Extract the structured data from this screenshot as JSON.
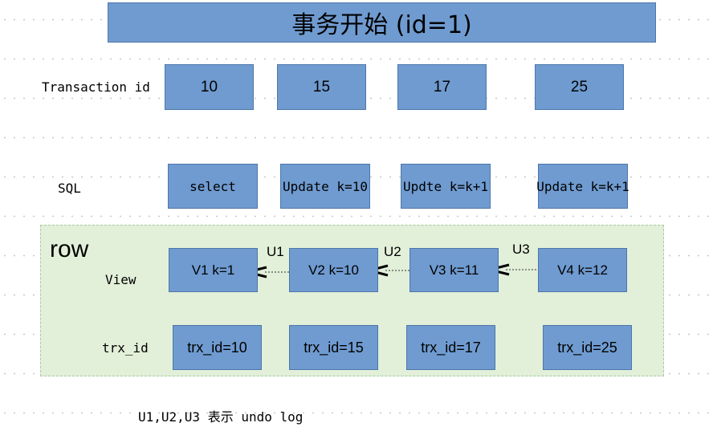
{
  "title": "事务开始 (id=1)",
  "labels": {
    "transaction_id": "Transaction id",
    "sql": "SQL",
    "row": "row",
    "view": "View",
    "trx_id": "trx_id"
  },
  "transactions": [
    "10",
    "15",
    "17",
    "25"
  ],
  "sql_statements": [
    "select",
    "Update k=10",
    "Updte k=k+1",
    "Update k=k+1"
  ],
  "versions": [
    "V1  k=1",
    "V2  k=10",
    "V3  k=11",
    "V4  k=12"
  ],
  "trx_ids": [
    "trx_id=10",
    "trx_id=15",
    "trx_id=17",
    "trx_id=25"
  ],
  "undo_links": [
    "U1",
    "U2",
    "U3"
  ],
  "note": "U1,U2,U3 表示 undo log",
  "colors": {
    "box_fill": "#6f9bd0",
    "box_border": "#4d77aa",
    "row_area": "#e2efd9"
  }
}
